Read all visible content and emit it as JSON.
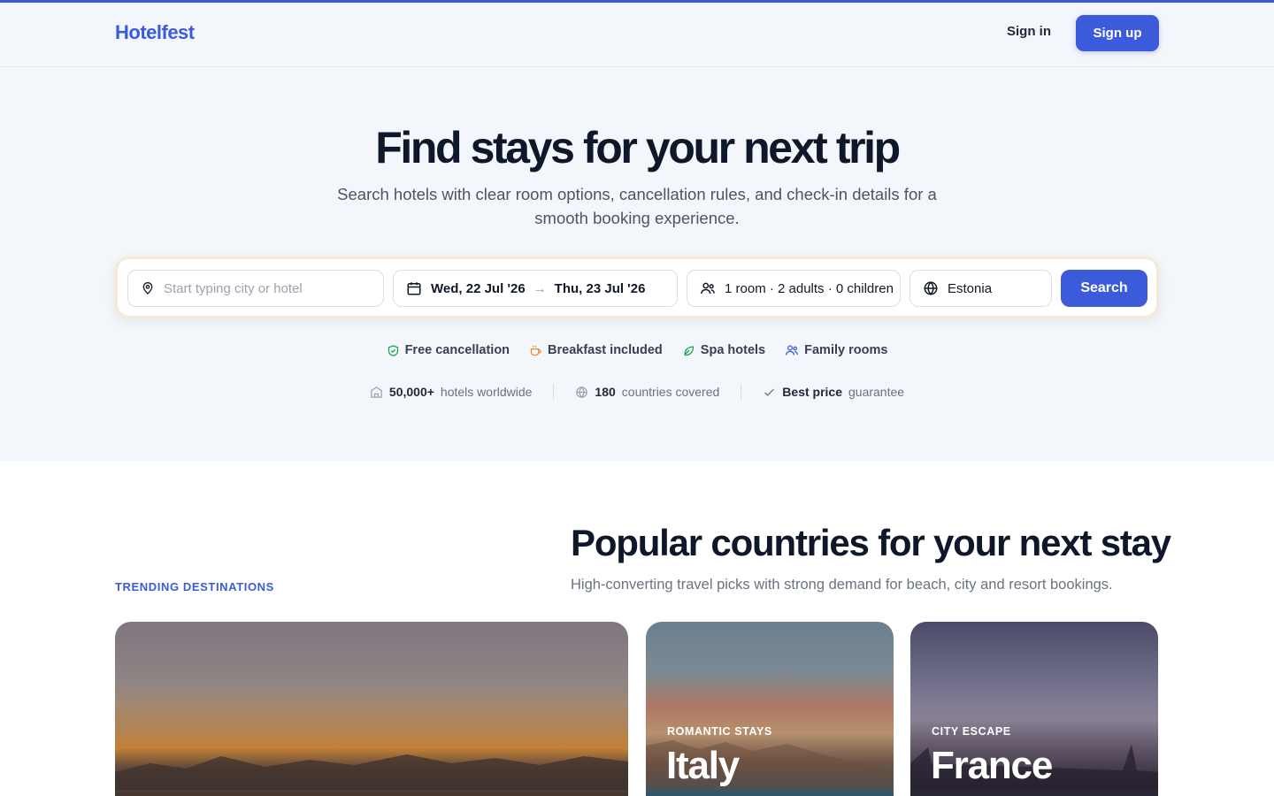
{
  "brand": {
    "name": "Hotelfest",
    "accent": "#3b5bdb"
  },
  "header": {
    "signin_label": "Sign in",
    "signup_label": "Sign up"
  },
  "hero": {
    "title": "Find stays for your next trip",
    "subtitle": "Search hotels with clear room options, cancellation rules, and check-in details for a smooth booking experience."
  },
  "search": {
    "destination_placeholder": "Start typing city or hotel",
    "destination_value": "",
    "check_in": "Wed, 22 Jul '26",
    "check_out": "Thu, 23 Jul '26",
    "guests": "1 room · 2 adults · 0 children",
    "country": "Estonia",
    "button_label": "Search"
  },
  "filters": [
    {
      "label": "Free cancellation",
      "icon": "shield-check-icon",
      "color": "#16a34a"
    },
    {
      "label": "Breakfast included",
      "icon": "coffee-cup-icon",
      "color": "#ea8a3a"
    },
    {
      "label": "Spa hotels",
      "icon": "leaf-icon",
      "color": "#16a34a"
    },
    {
      "label": "Family rooms",
      "icon": "users-icon",
      "color": "#3b5bdb"
    }
  ],
  "stats": [
    {
      "strong": "50,000+",
      "text": "hotels worldwide",
      "icon": "building-icon"
    },
    {
      "strong": "180",
      "text": "countries covered",
      "icon": "globe-icon"
    },
    {
      "strong": "Best price",
      "text": "guarantee",
      "icon": "check-icon"
    }
  ],
  "trending": {
    "label": "TRENDING DESTINATIONS",
    "title": "Popular countries for your next stay",
    "subtitle": "High-converting travel picks with strong demand for beach, city and resort bookings."
  },
  "cards": [
    {
      "kicker": "",
      "name": ""
    },
    {
      "kicker": "ROMANTIC STAYS",
      "name": "Italy"
    },
    {
      "kicker": "CITY ESCAPE",
      "name": "France"
    }
  ]
}
